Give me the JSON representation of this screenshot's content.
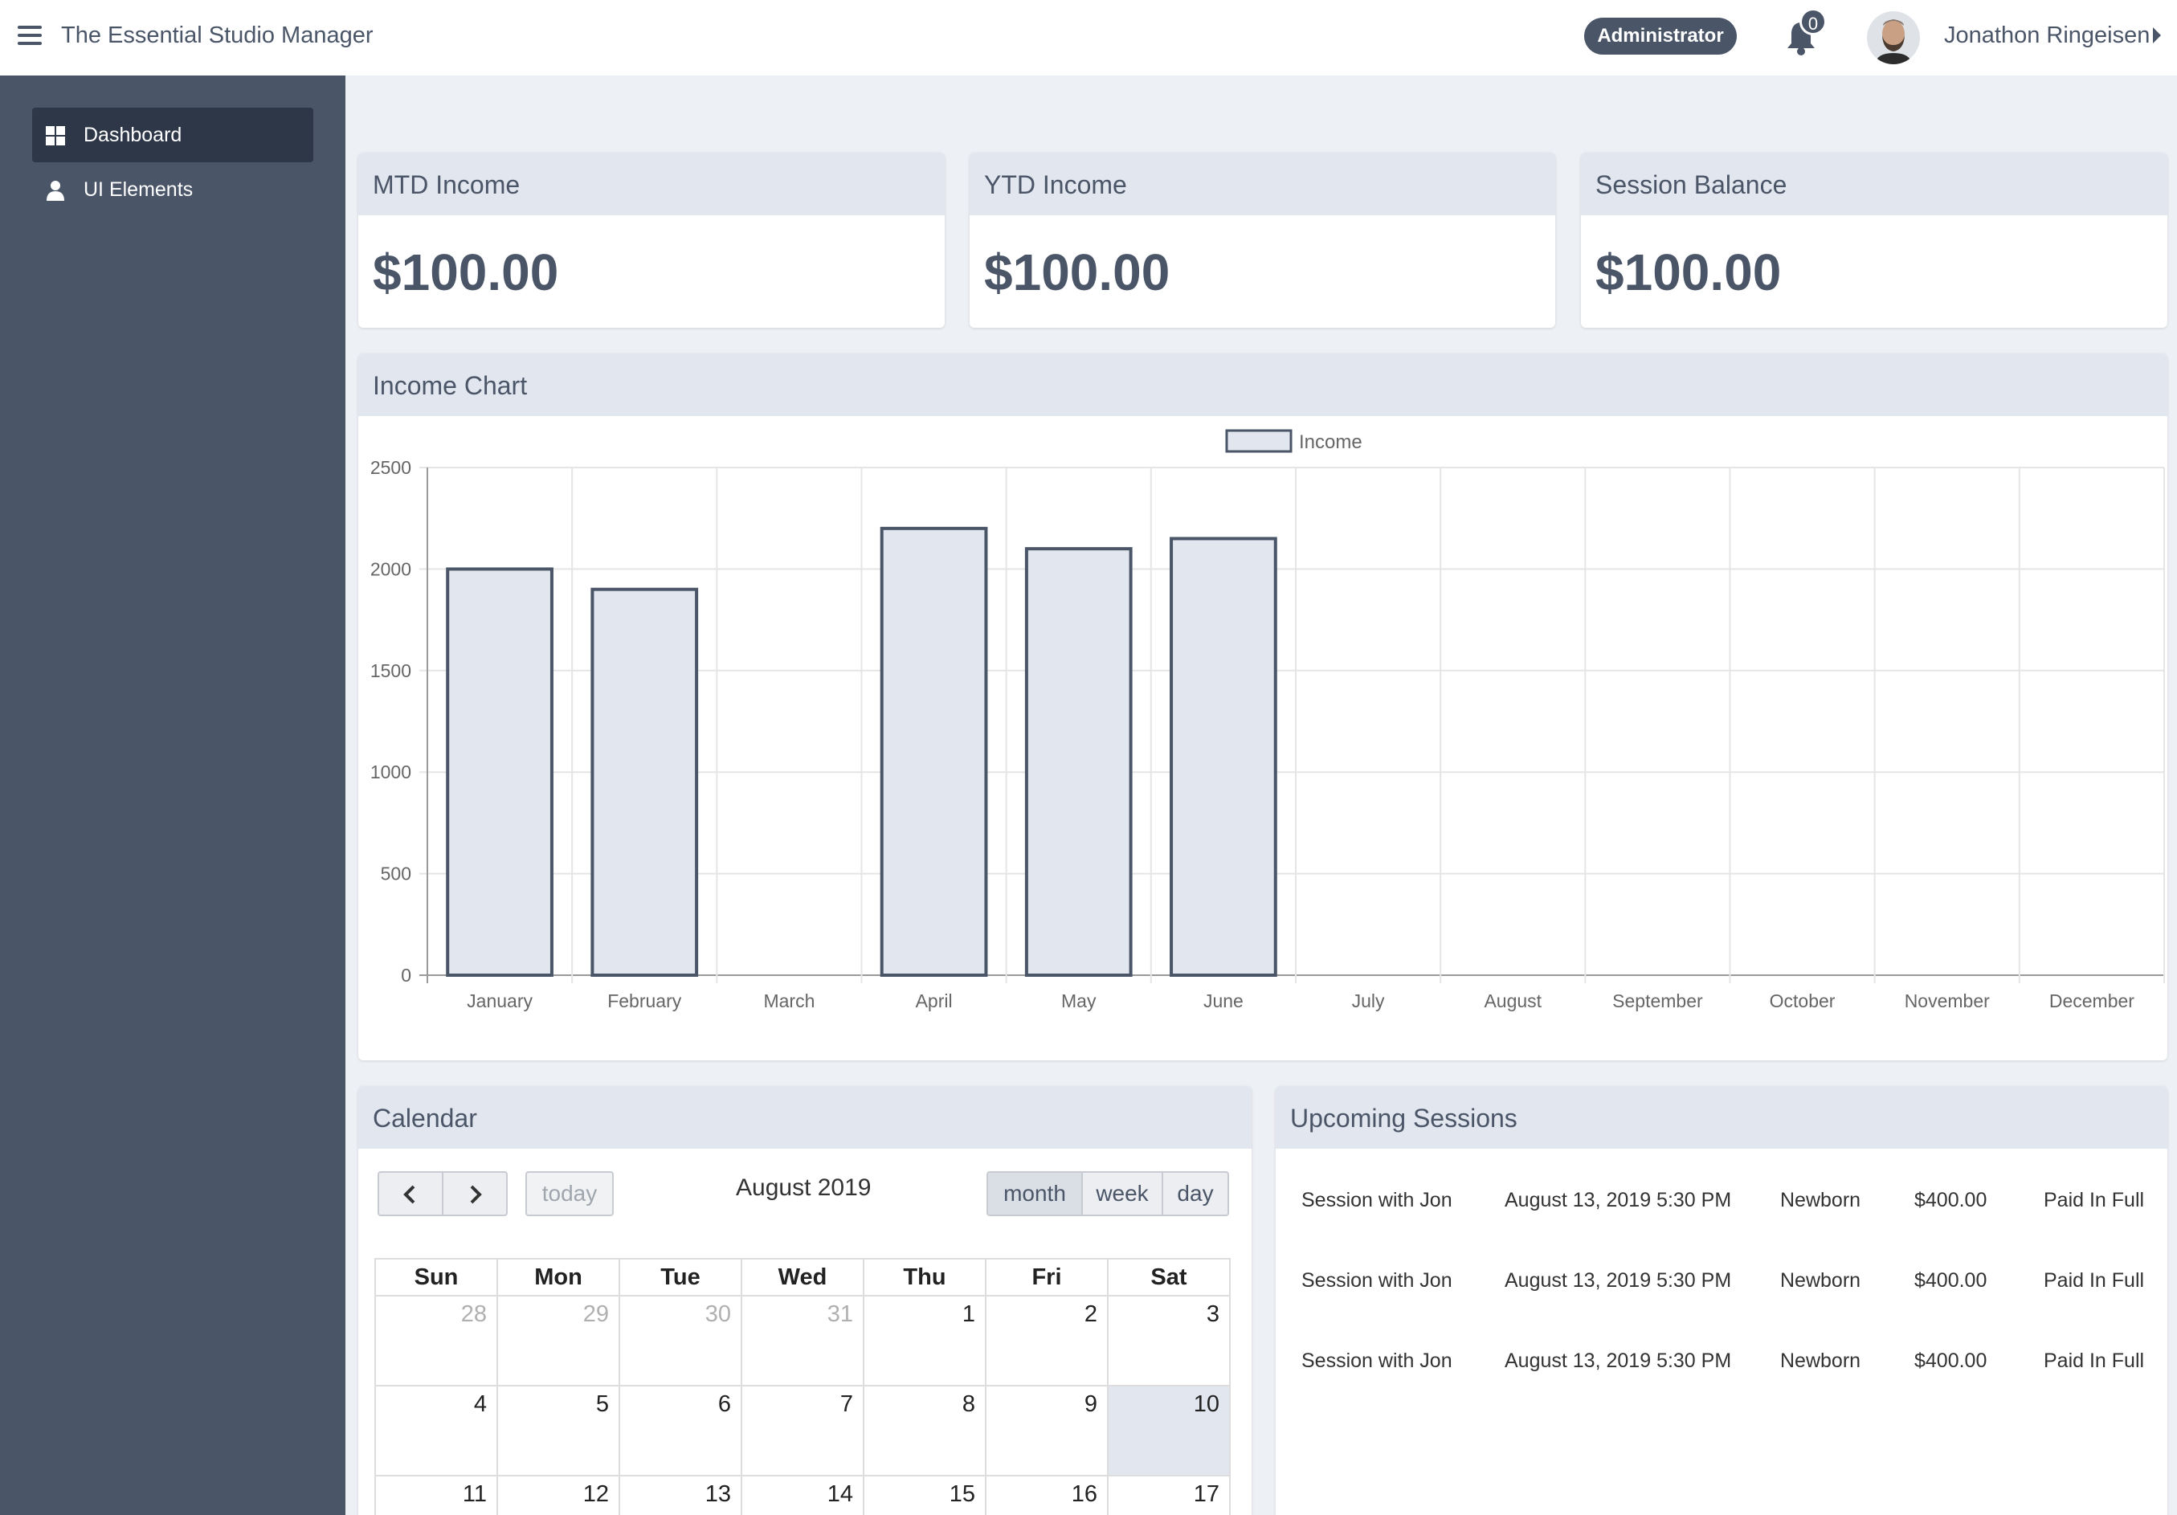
{
  "header": {
    "app_title": "The Essential Studio Manager",
    "role": "Administrator",
    "notification_count": "0",
    "user_name": "Jonathon Ringeisen"
  },
  "sidebar": {
    "items": [
      {
        "label": "Dashboard",
        "icon": "dashboard-grid-icon",
        "active": true
      },
      {
        "label": "UI Elements",
        "icon": "user-icon",
        "active": false
      }
    ]
  },
  "stats": [
    {
      "title": "MTD Income",
      "value": "$100.00"
    },
    {
      "title": "YTD Income",
      "value": "$100.00"
    },
    {
      "title": "Session Balance",
      "value": "$100.00"
    }
  ],
  "income_chart": {
    "title": "Income Chart"
  },
  "chart_data": {
    "type": "bar",
    "categories": [
      "January",
      "February",
      "March",
      "April",
      "May",
      "June",
      "July",
      "August",
      "September",
      "October",
      "November",
      "December"
    ],
    "series": [
      {
        "name": "Income",
        "values": [
          2000,
          1900,
          0,
          2200,
          2100,
          2150,
          0,
          0,
          0,
          0,
          0,
          0
        ]
      }
    ],
    "yticks": [
      "0",
      "500",
      "1000",
      "1500",
      "2000",
      "2500"
    ],
    "ylim": [
      0,
      2500
    ],
    "grid": true,
    "legend": "top-center",
    "colors": {
      "fill": "#e2e6ee",
      "stroke": "#4a5568"
    }
  },
  "calendar": {
    "title": "Calendar",
    "month_label": "August 2019",
    "today_label": "today",
    "views": [
      "month",
      "week",
      "day"
    ],
    "selected_view": "month",
    "weekdays": [
      "Sun",
      "Mon",
      "Tue",
      "Wed",
      "Thu",
      "Fri",
      "Sat"
    ],
    "weeks": [
      [
        {
          "d": "28",
          "other": true
        },
        {
          "d": "29",
          "other": true
        },
        {
          "d": "30",
          "other": true
        },
        {
          "d": "31",
          "other": true
        },
        {
          "d": "1"
        },
        {
          "d": "2"
        },
        {
          "d": "3"
        }
      ],
      [
        {
          "d": "4"
        },
        {
          "d": "5"
        },
        {
          "d": "6"
        },
        {
          "d": "7"
        },
        {
          "d": "8"
        },
        {
          "d": "9"
        },
        {
          "d": "10",
          "today": true
        }
      ],
      [
        {
          "d": "11"
        },
        {
          "d": "12"
        },
        {
          "d": "13"
        },
        {
          "d": "14"
        },
        {
          "d": "15"
        },
        {
          "d": "16"
        },
        {
          "d": "17"
        }
      ]
    ]
  },
  "sessions": {
    "title": "Upcoming Sessions",
    "rows": [
      {
        "name": "Session with Jon",
        "date": "August 13, 2019 5:30 PM",
        "type": "Newborn",
        "amount": "$400.00",
        "status": "Paid In Full"
      },
      {
        "name": "Session with Jon",
        "date": "August 13, 2019 5:30 PM",
        "type": "Newborn",
        "amount": "$400.00",
        "status": "Paid In Full"
      },
      {
        "name": "Session with Jon",
        "date": "August 13, 2019 5:30 PM",
        "type": "Newborn",
        "amount": "$400.00",
        "status": "Paid In Full"
      }
    ]
  }
}
